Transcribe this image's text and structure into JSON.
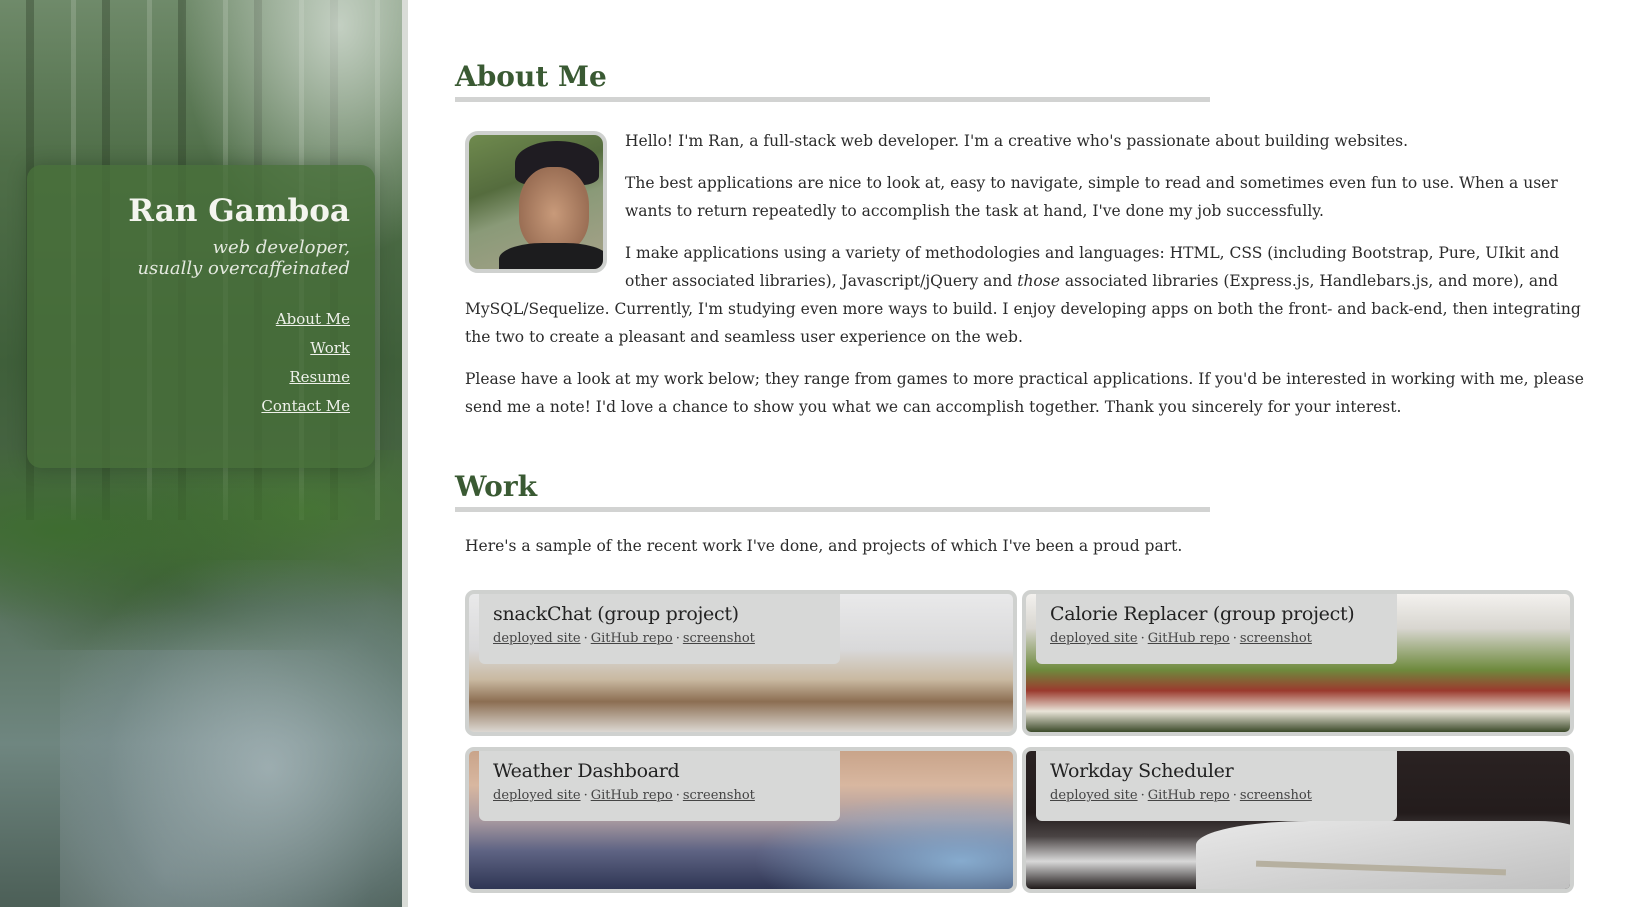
{
  "profile": {
    "name": "Ran Gamboa",
    "tagline_line1": "web developer,",
    "tagline_line2": "usually overcaffeinated",
    "nav": [
      "About Me",
      "Work",
      "Resume",
      "Contact Me"
    ]
  },
  "about": {
    "title": "About Me",
    "p1": "Hello! I'm Ran, a full-stack web developer. I'm a creative who's passionate about building websites.",
    "p2": "The best applications are nice to look at, easy to navigate, simple to read and sometimes even fun to use. When a user wants to return repeatedly to accomplish the task at hand, I've done my job successfully.",
    "p3_before": "I make applications using a variety of methodologies and languages: HTML, CSS (including Bootstrap, Pure, UIkit and other associated libraries), Javascript/jQuery and ",
    "p3_em": "those",
    "p3_after": " associated libraries (Express.js, Handlebars.js, and more), and MySQL/Sequelize. Currently, I'm studying even more ways to build. I enjoy developing apps on both the front- and back-end, then integrating the two to create a pleasant and seamless user experience on the web.",
    "p4": "Please have a look at my work below; they range from games to more practical applications. If you'd be interested in working with me, please send me a note! I'd love a chance to show you what we can accomplish together. Thank you sincerely for your interest."
  },
  "work": {
    "title": "Work",
    "intro": "Here's a sample of the recent work I've done, and projects of which I've been a proud part.",
    "link_labels": {
      "deployed": "deployed site",
      "repo": "GitHub repo",
      "screenshot": "screenshot",
      "separator": "·"
    },
    "projects": [
      {
        "title": "snackChat (group project)"
      },
      {
        "title": "Calorie Replacer (group project)"
      },
      {
        "title": "Weather Dashboard"
      },
      {
        "title": "Workday Scheduler"
      }
    ]
  }
}
